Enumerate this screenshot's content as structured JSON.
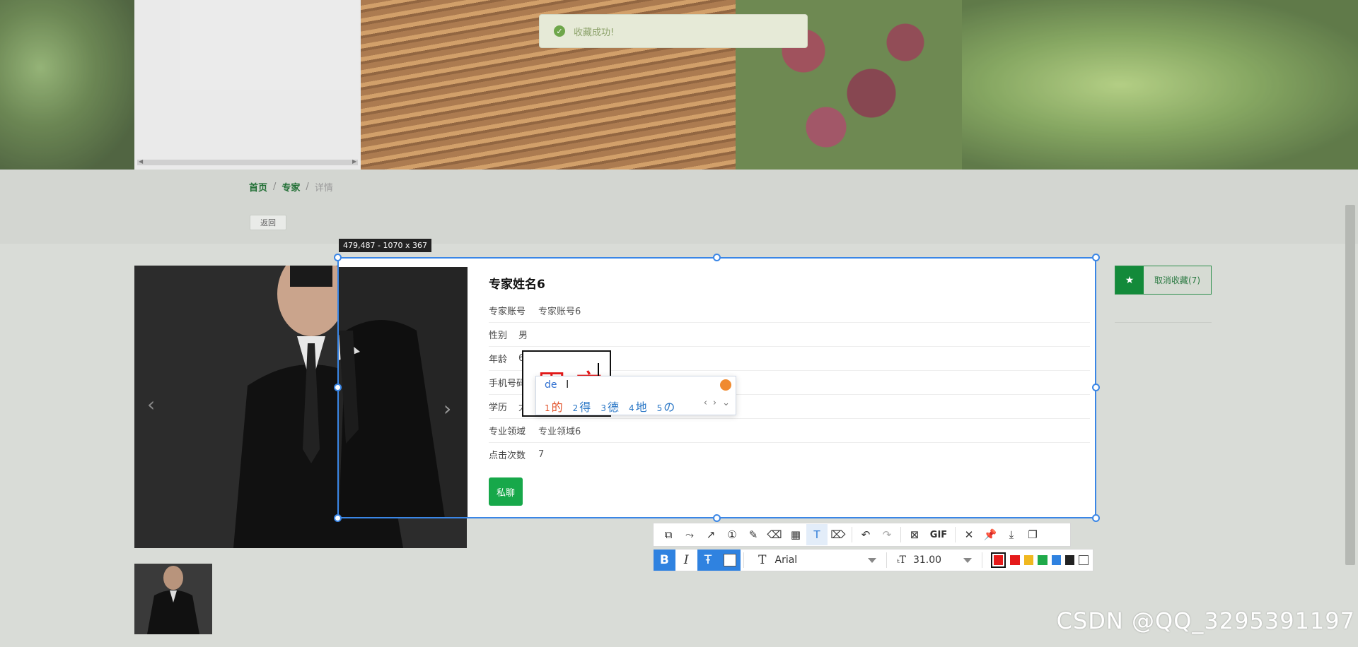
{
  "toast": {
    "message": "收藏成功!"
  },
  "breadcrumb": {
    "home": "首页",
    "sep1": "/",
    "expert": "专家",
    "sep2": "/",
    "current": "详情"
  },
  "back_button": "返回",
  "selection_label": "479,487 - 1070 x 367",
  "expert": {
    "name": "专家姓名6",
    "rows": [
      {
        "key": "专家账号",
        "value": "专家账号6"
      },
      {
        "key": "性别",
        "value": "男"
      },
      {
        "key": "年龄",
        "value": "6"
      },
      {
        "key": "手机号码",
        "value": ""
      },
      {
        "key": "学历",
        "value": "大专"
      },
      {
        "key": "专业领域",
        "value": "专业领域6"
      },
      {
        "key": "点击次数",
        "value": "7"
      }
    ],
    "chat_button": "私聊"
  },
  "favorite": {
    "label": "取消收藏(7)"
  },
  "photo_nav": {
    "prev": "‹",
    "next": "›"
  },
  "textbox": {
    "typed": "田 宀"
  },
  "ime": {
    "input": "de",
    "candidates": [
      {
        "n": "1",
        "text": "的"
      },
      {
        "n": "2",
        "text": "得"
      },
      {
        "n": "3",
        "text": "德"
      },
      {
        "n": "4",
        "text": "地"
      },
      {
        "n": "5",
        "text": "の"
      }
    ]
  },
  "toolbar": {
    "gif_label": "GIF",
    "font_name": "Arial",
    "font_size": "31.00",
    "colors": [
      "#e51a1a",
      "#e51a1a",
      "#f0b820",
      "#1faa4a",
      "#2f82e0",
      "#222222",
      "#ffffff"
    ],
    "selected_color": "#e51a1a"
  },
  "watermark": "CSDN @QQ_3295391197"
}
